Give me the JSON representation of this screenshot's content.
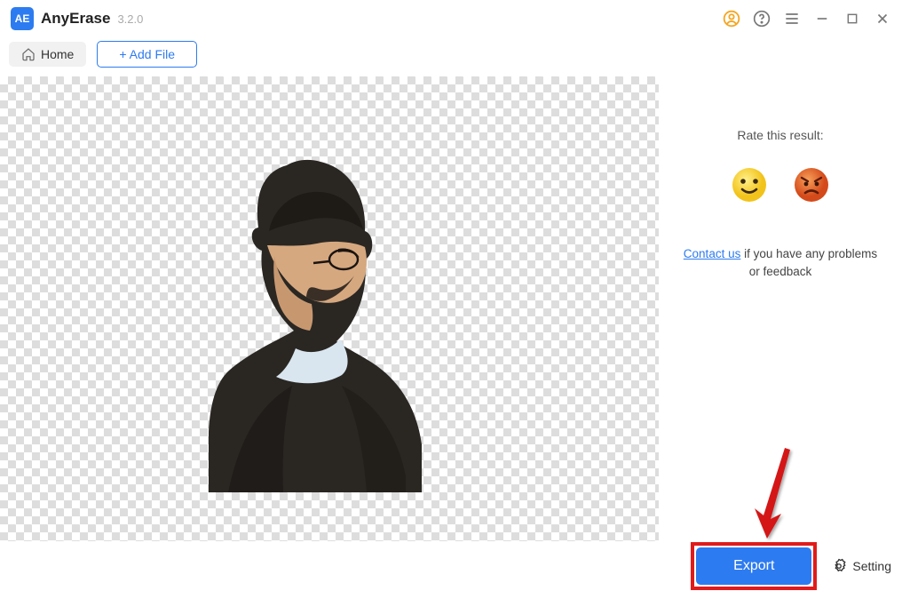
{
  "app": {
    "icon_text": "AE",
    "name": "AnyErase",
    "version": "3.2.0"
  },
  "toolbar": {
    "home_label": "Home",
    "add_file_label": "+ Add File"
  },
  "sidebar": {
    "rate_label": "Rate this result:",
    "contact_text": "Contact us",
    "feedback_suffix": " if you have any problems or feedback"
  },
  "bottom": {
    "export_label": "Export",
    "setting_label": "Setting"
  }
}
